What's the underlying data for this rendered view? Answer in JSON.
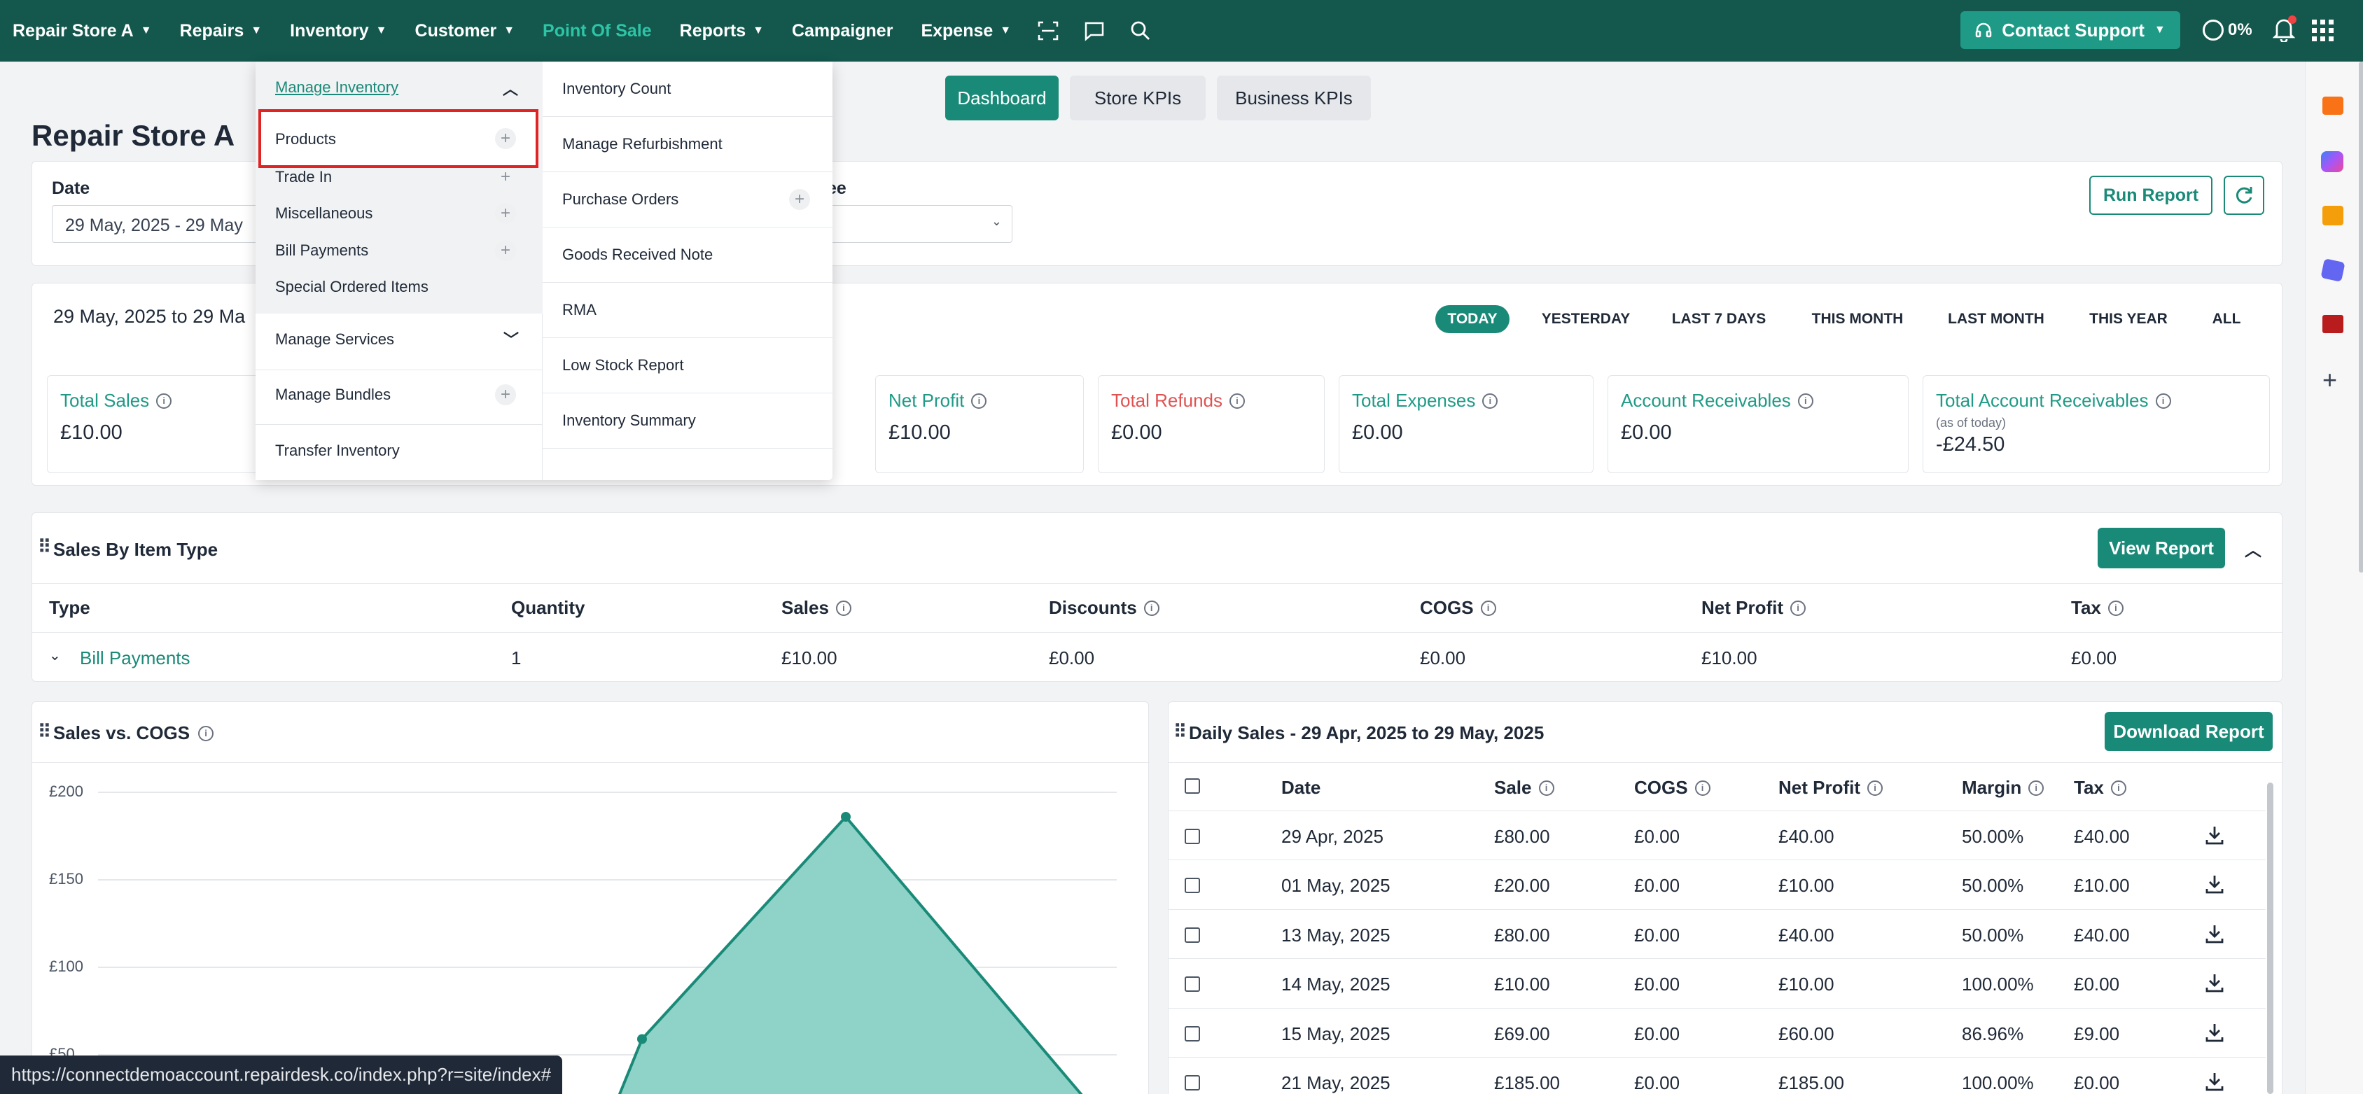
{
  "nav": {
    "store": "Repair Store A",
    "items": [
      "Repairs",
      "Inventory",
      "Customer",
      "Point Of Sale",
      "Reports",
      "Campaigner",
      "Expense"
    ],
    "support_label": "Contact Support",
    "progress": "0%"
  },
  "tabs": [
    "Dashboard",
    "Store KPIs",
    "Business KPIs"
  ],
  "page_title": "Repair Store A",
  "filters": {
    "date_label": "Date",
    "date_value": "29 May, 2025 - 29 May",
    "employee_label": "ee",
    "run_report": "Run Report"
  },
  "range": {
    "text": "29 May, 2025 to 29 Ma",
    "buttons": [
      "TODAY",
      "YESTERDAY",
      "LAST 7 DAYS",
      "THIS MONTH",
      "LAST MONTH",
      "THIS YEAR",
      "ALL"
    ]
  },
  "kpis": [
    {
      "label": "Total Sales",
      "value": "£10.00"
    },
    {
      "label": "Net Profit",
      "value": "£10.00"
    },
    {
      "label": "Total Refunds",
      "value": "£0.00"
    },
    {
      "label": "Total Expenses",
      "value": "£0.00"
    },
    {
      "label": "Account Receivables",
      "value": "£0.00"
    },
    {
      "label": "Total Account Receivables",
      "sub": "(as of today)",
      "value": "-£24.50"
    }
  ],
  "sales_by_type": {
    "title": "Sales By Item Type",
    "view_report": "View Report",
    "headers": [
      "Type",
      "Quantity",
      "Sales",
      "Discounts",
      "COGS",
      "Net Profit",
      "Tax"
    ],
    "row": [
      "Bill Payments",
      "1",
      "£10.00",
      "£0.00",
      "£0.00",
      "£10.00",
      "£0.00"
    ]
  },
  "sales_cogs": {
    "title": "Sales vs. COGS",
    "ticks": [
      "£200",
      "£150",
      "£100",
      "£50"
    ]
  },
  "chart_data": {
    "type": "area",
    "title": "Sales vs. COGS",
    "ylim": [
      0,
      200
    ],
    "y_ticks": [
      50,
      100,
      150,
      200
    ],
    "series": [
      {
        "values": [
          59,
          186,
          20
        ]
      }
    ],
    "grid": true
  },
  "daily_sales": {
    "title": "Daily Sales - 29 Apr, 2025 to 29 May, 2025",
    "download": "Download Report",
    "headers": [
      "Date",
      "Sale",
      "COGS",
      "Net Profit",
      "Margin",
      "Tax"
    ],
    "rows": [
      [
        "29 Apr, 2025",
        "£80.00",
        "£0.00",
        "£40.00",
        "50.00%",
        "£40.00"
      ],
      [
        "01 May, 2025",
        "£20.00",
        "£0.00",
        "£10.00",
        "50.00%",
        "£10.00"
      ],
      [
        "13 May, 2025",
        "£80.00",
        "£0.00",
        "£40.00",
        "50.00%",
        "£40.00"
      ],
      [
        "14 May, 2025",
        "£10.00",
        "£0.00",
        "£10.00",
        "100.00%",
        "£0.00"
      ],
      [
        "15 May, 2025",
        "£69.00",
        "£0.00",
        "£60.00",
        "86.96%",
        "£9.00"
      ],
      [
        "21 May, 2025",
        "£185.00",
        "£0.00",
        "£185.00",
        "100.00%",
        "£0.00"
      ]
    ]
  },
  "dropdown": {
    "manage_inventory": "Manage Inventory",
    "left_items": [
      "Products",
      "Trade In",
      "Miscellaneous",
      "Bill Payments",
      "Special Ordered Items"
    ],
    "manage_services": "Manage Services",
    "manage_bundles": "Manage Bundles",
    "transfer_inventory": "Transfer Inventory",
    "right_items": [
      "Inventory Count",
      "Manage Refurbishment",
      "Purchase Orders",
      "Goods Received Note",
      "RMA",
      "Low Stock Report",
      "Inventory Summary"
    ]
  },
  "status_url": "https://connectdemoaccount.repairdesk.co/index.php?r=site/index#",
  "colors": {
    "nav_bg": "#13574d",
    "accent": "#1a8a78",
    "active_nav": "#2ec4a6",
    "refund": "#e05252"
  }
}
